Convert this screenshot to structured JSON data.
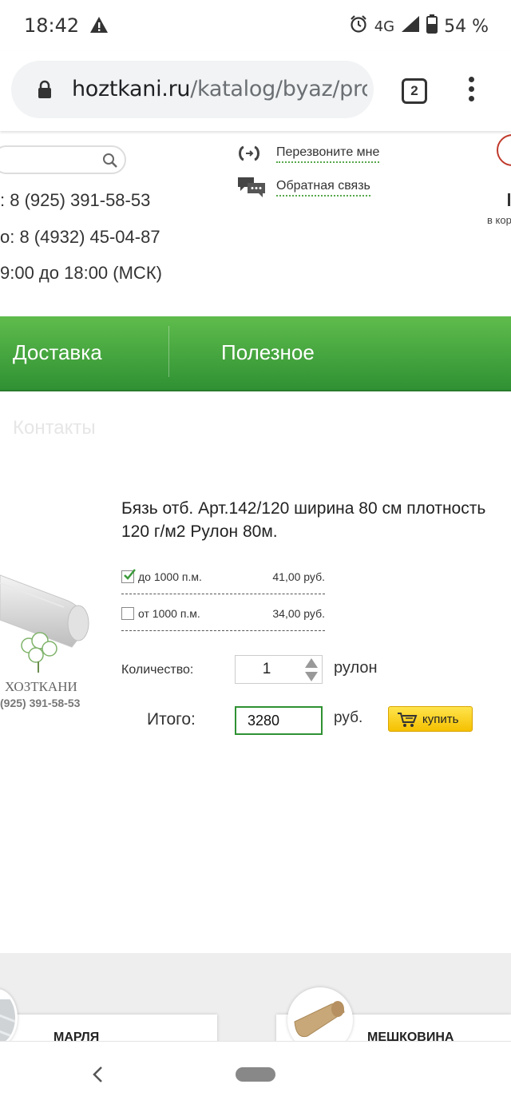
{
  "status_bar": {
    "time": "18:42",
    "network": "4G",
    "battery": "54 %",
    "icons": [
      "warning-icon",
      "alarm-icon",
      "signal-icon",
      "battery-icon"
    ]
  },
  "browser": {
    "url_host": "hoztkani.ru",
    "url_path": "/katalog/byaz/prc",
    "tab_count": "2"
  },
  "header": {
    "phone_1": ": 8 (925) 391-58-53",
    "phone_2": "о: 8 (4932) 45-04-87",
    "hours": "9:00 до 18:00 (МСК)",
    "callback_label": "Перезвоните мне",
    "feedback_label": "Обратная связь",
    "cart_count_partial": "",
    "cart_label_partial": "в кор"
  },
  "nav": {
    "items": [
      {
        "label": "Доставка"
      },
      {
        "label": "Полезное"
      }
    ],
    "faded_item": "Контакты"
  },
  "product": {
    "title": "Бязь отб. Арт.142/120 ширина 80 см плотность 120 г/м2 Рулон 80м.",
    "image_brand": "ХОЗТКАНИ",
    "image_phone": "(925) 391-58-53",
    "price_options": [
      {
        "label": "до 1000 п.м.",
        "price": "41,00 руб.",
        "checked": true
      },
      {
        "label": "от 1000 п.м.",
        "price": "34,00 руб.",
        "checked": false
      }
    ],
    "quantity_label": "Количество:",
    "quantity_value": "1",
    "quantity_unit": "рулон",
    "total_label": "Итого:",
    "total_value": "3280",
    "total_unit": "руб.",
    "buy_label": "купить"
  },
  "categories": [
    {
      "name": "МАРЛЯ"
    },
    {
      "name": "МЕШКОВИНА"
    }
  ],
  "colors": {
    "nav_green_top": "#5fbc4c",
    "nav_green_bottom": "#2f9133",
    "buy_yellow": "#f5c000",
    "accent_red": "#c0392b"
  }
}
